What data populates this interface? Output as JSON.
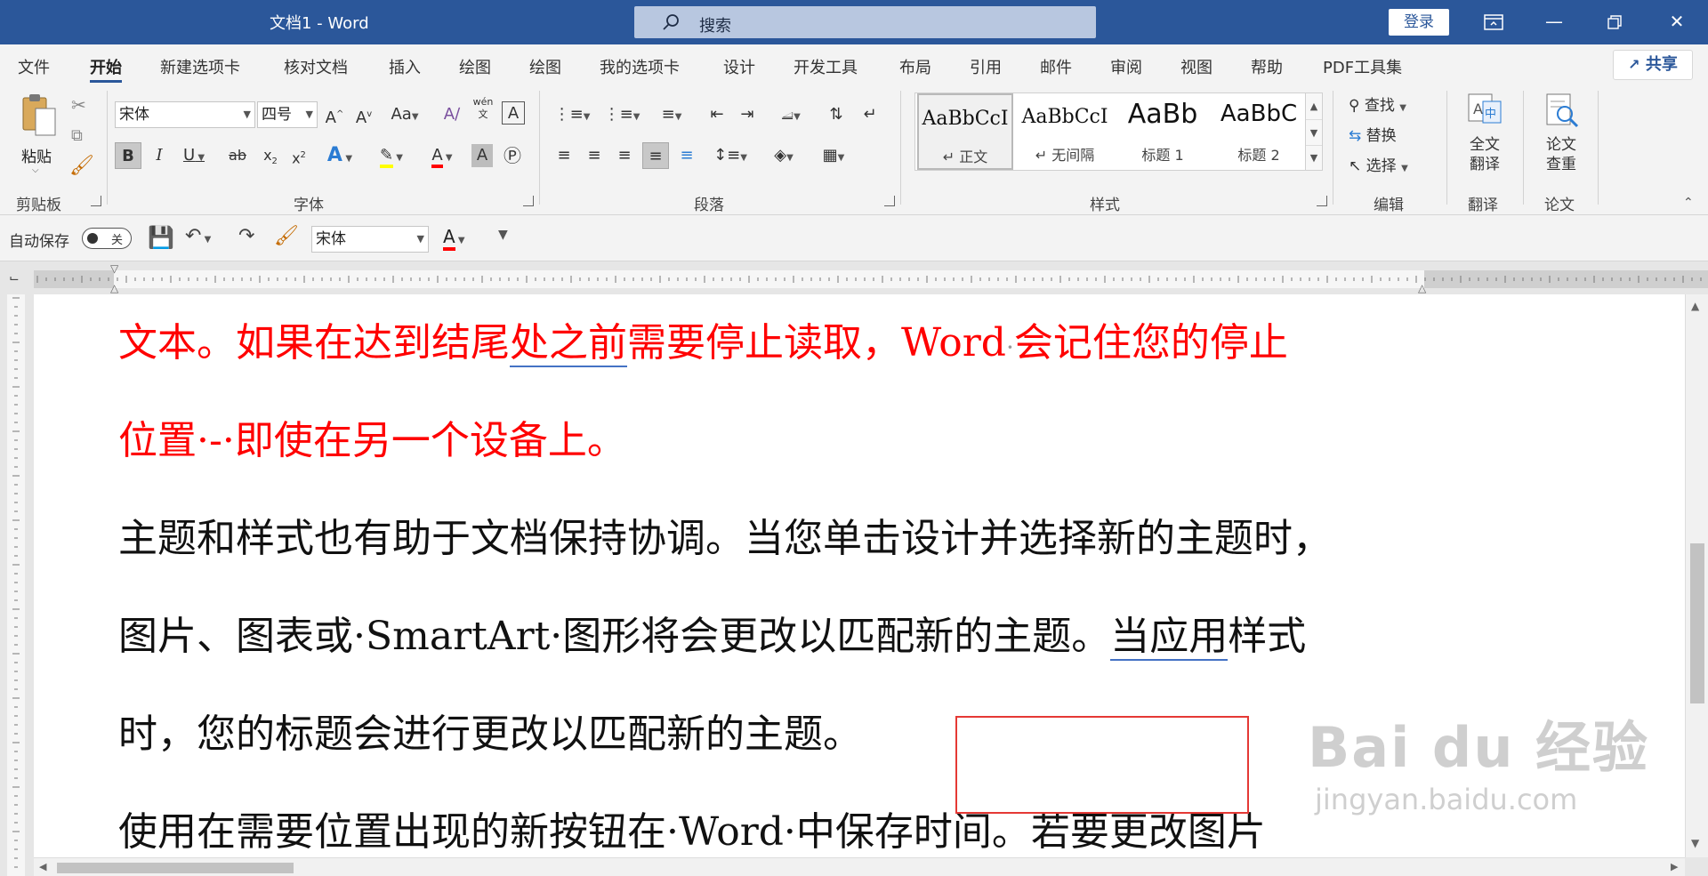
{
  "titlebar": {
    "doc_title": "文档1  -  Word",
    "search_label": "搜索",
    "login_label": "登录"
  },
  "menu": {
    "items": [
      "文件",
      "开始",
      "新建选项卡",
      "核对文档",
      "插入",
      "绘图",
      "绘图",
      "我的选项卡",
      "设计",
      "开发工具",
      "布局",
      "引用",
      "邮件",
      "审阅",
      "视图",
      "帮助",
      "PDF工具集"
    ],
    "active_index": 1,
    "share_label": "共享"
  },
  "ribbon": {
    "clipboard": {
      "paste_label": "粘贴",
      "group_label": "剪贴板"
    },
    "font": {
      "font_name": "宋体",
      "font_size": "四号",
      "group_label": "字体",
      "pinyin_label": "wén"
    },
    "paragraph": {
      "group_label": "段落"
    },
    "styles": {
      "group_label": "样式",
      "items": [
        {
          "sample": "AaBbCcI",
          "name": "↵ 正文"
        },
        {
          "sample": "AaBbCcI",
          "name": "↵ 无间隔"
        },
        {
          "sample": "AaBb",
          "name": "标题 1"
        },
        {
          "sample": "AaBbC",
          "name": "标题 2"
        }
      ]
    },
    "editing": {
      "group_label": "编辑",
      "find_label": "查找",
      "replace_label": "替换",
      "select_label": "选择"
    },
    "translate": {
      "button_label": "全文\n翻译",
      "group_label": "翻译"
    },
    "paper": {
      "button_label": "论文\n查重",
      "group_label": "论文"
    }
  },
  "qat": {
    "autosave_label": "自动保存",
    "toggle_state": "关",
    "font_name": "宋体"
  },
  "document": {
    "para1_line1_a": "文本。如果在达到结尾",
    "para1_line1_b": "处之前",
    "para1_line1_c": "需要停止读取，Word",
    "para1_line1_d": "会记住您的停止",
    "para1_line2": "位置·-·即使在另一个设备上。",
    "para2_line1": "主题和样式也有助于文档保持协调。当您单击设计并选择新的主题时，",
    "para2_line2_a": "图片、图表或·SmartArt·图形将会更改以匹配新的主题。",
    "para2_line2_b": "当应用",
    "para2_line2_c": "样式",
    "para2_line3": "时，您的标题会进行更改以匹配新的主题。",
    "para3_line1": "使用在需要位置出现的新按钮在·Word·中保存时间。若要更改图片"
  },
  "watermark": {
    "main": "Bai du 经验",
    "sub": "jingyan.baidu.com"
  },
  "colors": {
    "title_bar": "#2b579a",
    "red_text": "#ff0000",
    "highlight_box": "#e53935"
  }
}
